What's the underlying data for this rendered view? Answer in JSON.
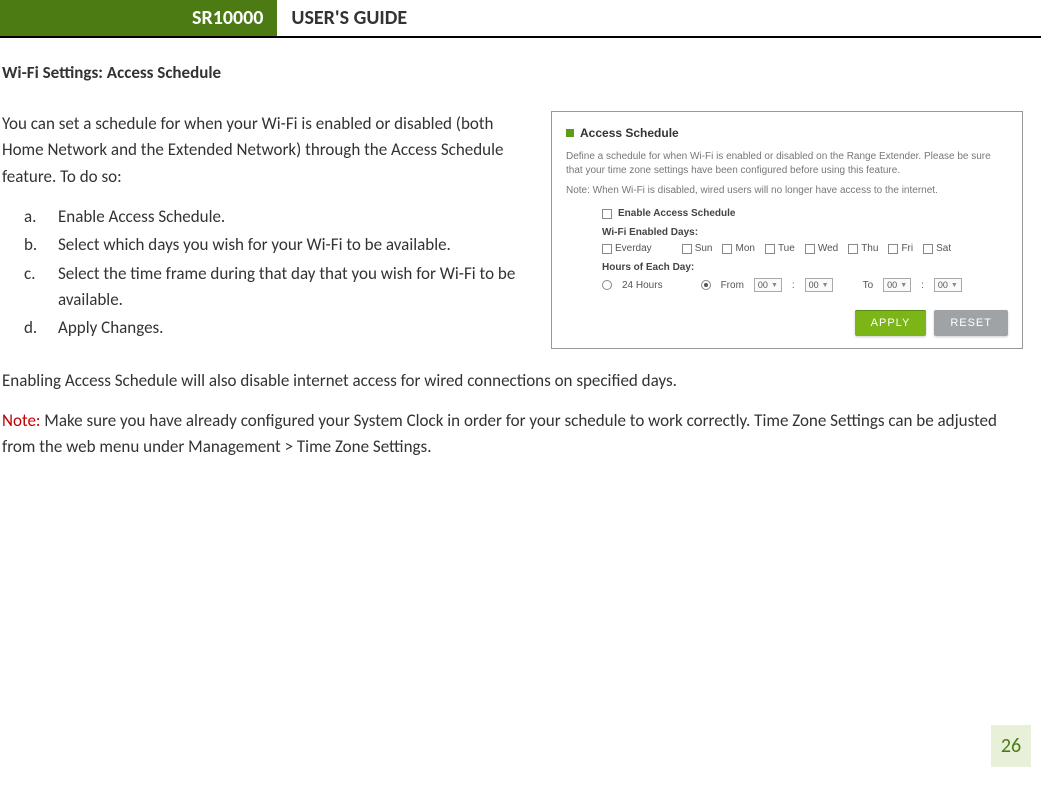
{
  "header": {
    "model": "SR10000",
    "title": "USER'S GUIDE"
  },
  "section_title": "Wi-Fi Settings: Access Schedule",
  "intro": "You can set a schedule for when your Wi-Fi is enabled or disabled (both Home Network and the Extended Network) through the Access Schedule feature.  To do so:",
  "steps": [
    {
      "marker": "a.",
      "text": "Enable Access Schedule."
    },
    {
      "marker": "b.",
      "text": "Select which days you wish for your Wi-Fi to be available."
    },
    {
      "marker": "c.",
      "text": "Select the time frame during that day that you wish for Wi-Fi to be available."
    },
    {
      "marker": "d.",
      "text": "Apply Changes."
    }
  ],
  "after": "Enabling Access Schedule will also disable internet access for wired connections on specified days.",
  "note_label": "Note:",
  "note_text": "  Make sure you have already configured your System Clock in order for your schedule to work correctly. Time Zone Settings can be adjusted from the web menu under Management > Time Zone Settings.",
  "screenshot": {
    "title": "Access Schedule",
    "desc": "Define a schedule for when Wi-Fi is enabled or disabled on the Range Extender. Please be sure that your time zone settings have been configured before using this feature.",
    "note": "Note: When Wi-Fi is disabled, wired users will no longer have access to the internet.",
    "enable_label": "Enable Access Schedule",
    "days_label": "Wi-Fi Enabled Days:",
    "days": [
      "Everday",
      "Sun",
      "Mon",
      "Tue",
      "Wed",
      "Thu",
      "Fri",
      "Sat"
    ],
    "hours_label": "Hours of Each Day:",
    "opt_24": "24 Hours",
    "opt_from": "From",
    "to_label": "To",
    "sel_value": "00",
    "apply": "APPLY",
    "reset": "RESET"
  },
  "page_number": "26"
}
